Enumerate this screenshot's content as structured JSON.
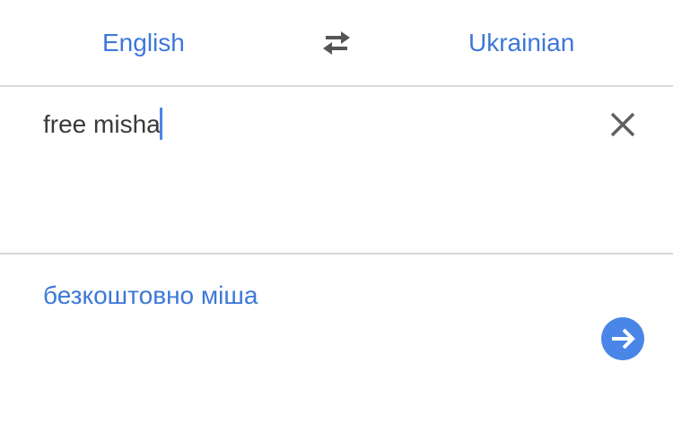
{
  "languages": {
    "source": "English",
    "target": "Ukrainian",
    "swap_icon": "swap-arrows-icon"
  },
  "input": {
    "text": "free misha",
    "clear_icon": "close-icon"
  },
  "result": {
    "text": "безкоштовно міша",
    "go_icon": "arrow-right-circle-icon"
  },
  "colors": {
    "accent": "#3c78d8",
    "button": "#4a86e8",
    "text": "#3a3a3a",
    "divider": "#d8d8d8"
  }
}
